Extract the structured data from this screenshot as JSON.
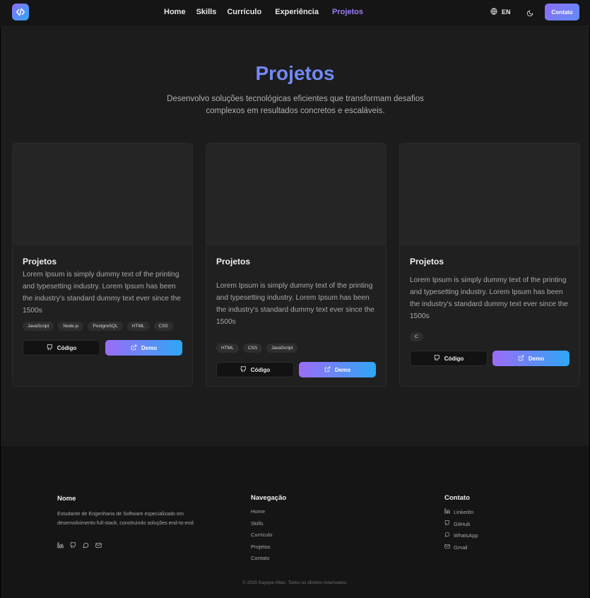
{
  "nav": {
    "links": [
      "Home",
      "Skills",
      "Currículo",
      "Experiência",
      "Projetos"
    ],
    "active": "Projetos",
    "language": "EN",
    "contact_label": "Contato"
  },
  "hero": {
    "title": "Projetos",
    "subtitle": "Desenvolvo soluções tecnológicas eficientes que transformam desafios complexos em resultados concretos e escaláveis."
  },
  "projects": [
    {
      "title": "Projetos",
      "description": "Lorem Ipsum is simply dummy text of the printing and typesetting industry. Lorem Ipsum has been the industry's standard dummy text ever since the 1500s",
      "tags": [
        "JavaScript",
        "Node.js",
        "PostgreSQL",
        "HTML",
        "CSS"
      ],
      "code_label": "Código",
      "demo_label": "Demo"
    },
    {
      "title": "Projetos",
      "description": "Lorem Ipsum is simply dummy text of the printing and typesetting industry. Lorem Ipsum has been the industry's standard dummy text ever since the 1500s",
      "tags": [
        "HTML",
        "CSS",
        "JavaScript"
      ],
      "code_label": "Código",
      "demo_label": "Demo"
    },
    {
      "title": "Projetos",
      "description": "Lorem Ipsum is simply dummy text of the printing and typesetting industry. Lorem Ipsum has been the industry's standard dummy text ever since the 1500s",
      "tags": [
        "C"
      ],
      "code_label": "Código",
      "demo_label": "Demo"
    }
  ],
  "footer": {
    "name_heading": "Nome",
    "bio": "Estudante de Engenharia de Software especializado em desenvolvimento full-stack, construindo soluções end-to-end.",
    "nav_heading": "Navegação",
    "nav_links": [
      "Home",
      "Skills",
      "Currículo",
      "Projetos",
      "Contato"
    ],
    "contact_heading": "Contato",
    "contact_links": [
      "LinkedIn",
      "GitHub",
      "WhatsApp",
      "Gmail"
    ],
    "copyright": "© 2025 Kayque Allan. Todos os direitos reservados."
  },
  "colors": {
    "accent_purple": "#9b6cf6",
    "accent_blue": "#2ea7f6",
    "background": "#1c1c1c"
  }
}
